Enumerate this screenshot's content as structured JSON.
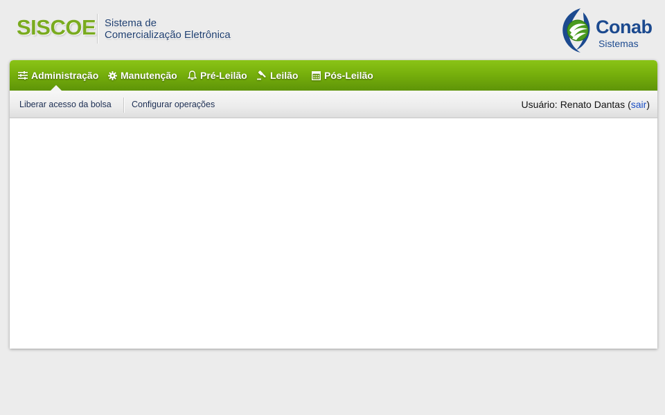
{
  "header": {
    "logo_text": "SISCOE",
    "system_name_line1": "Sistema de",
    "system_name_line2": "Comercialização Eletrônica",
    "brand": {
      "name": "Conab",
      "sub": "Sistemas"
    }
  },
  "menu": {
    "items": [
      {
        "label": "Administração",
        "icon": "sliders-icon"
      },
      {
        "label": "Manutenção",
        "icon": "gear-icon"
      },
      {
        "label": "Pré-Leilão",
        "icon": "bell-icon"
      },
      {
        "label": "Leilão",
        "icon": "gavel-icon"
      },
      {
        "label": "Pós-Leilão",
        "icon": "calculator-icon"
      }
    ],
    "active_index": 0
  },
  "submenu": {
    "items": [
      {
        "label": "Liberar acesso da bolsa"
      },
      {
        "label": "Configurar operações"
      }
    ]
  },
  "user": {
    "prefix": "Usuário:",
    "name": "Renato Dantas",
    "open_paren": "(",
    "logout_label": "sair",
    "close_paren": ")"
  },
  "colors": {
    "menu_green_top": "#8ac417",
    "menu_green_bottom": "#5e9408",
    "siscoe_green": "#7aab1f",
    "brand_blue": "#1c4a8f",
    "link_blue": "#1c4fc4",
    "background": "#ececec"
  }
}
